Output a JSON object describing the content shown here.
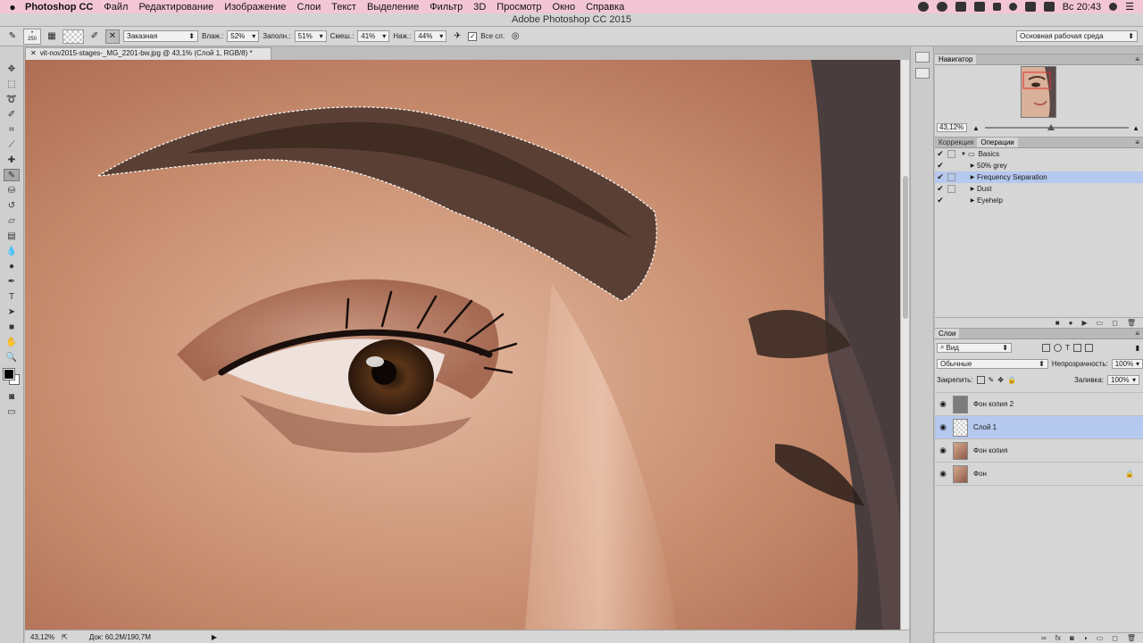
{
  "menubar": {
    "app_name": "Photoshop CC",
    "items": [
      "Файл",
      "Редактирование",
      "Изображение",
      "Слои",
      "Текст",
      "Выделение",
      "Фильтр",
      "3D",
      "Просмотр",
      "Окно",
      "Справка"
    ],
    "time": "Вс 20:43"
  },
  "window": {
    "title": "Adobe Photoshop CC 2015"
  },
  "options": {
    "brush_size": "250",
    "mode": "Заказная",
    "wet_label": "Влаж.:",
    "wet_value": "52%",
    "load_label": "Заполн.:",
    "load_value": "51%",
    "mix_label": "Смеш.:",
    "mix_value": "41%",
    "flow_label": "Наж.:",
    "flow_value": "44%",
    "all_layers_label": "Все сл.",
    "workspace": "Основная рабочая среда"
  },
  "document": {
    "tab_title": "vit-nov2015-stages-_MG_2201-bw.jpg @ 43,1% (Слой 1, RGB/8) *"
  },
  "status": {
    "zoom": "43,12%",
    "doc_size": "Док: 60,2M/190,7M"
  },
  "navigator": {
    "title": "Навигатор",
    "zoom": "43,12%"
  },
  "actions_panel": {
    "tabs": [
      "Коррекция",
      "Операции"
    ],
    "items": [
      {
        "label": "Basics",
        "checked": true,
        "has_dialog": false,
        "expanded": true,
        "is_set": true
      },
      {
        "label": "50% grey",
        "checked": true,
        "has_dialog": false,
        "selected": false
      },
      {
        "label": "Frequency Separation",
        "checked": true,
        "has_dialog": true,
        "selected": true
      },
      {
        "label": "Dust",
        "checked": true,
        "has_dialog": true,
        "selected": false
      },
      {
        "label": "Eyehelp",
        "checked": true,
        "has_dialog": false,
        "selected": false
      }
    ]
  },
  "layers_panel": {
    "title": "Слои",
    "filter": "Вид",
    "blend_mode": "Обычные",
    "opacity_label": "Непрозрачность:",
    "opacity_value": "100%",
    "lock_label": "Закрепить:",
    "fill_label": "Заливка:",
    "fill_value": "100%",
    "layers": [
      {
        "name": "Фон копия 2",
        "visible": true,
        "selected": false,
        "thumb": "gray",
        "locked": false
      },
      {
        "name": "Слой 1",
        "visible": true,
        "selected": true,
        "thumb": "transparent",
        "locked": false
      },
      {
        "name": "Фон копия",
        "visible": true,
        "selected": false,
        "thumb": "face",
        "locked": false
      },
      {
        "name": "Фон",
        "visible": true,
        "selected": false,
        "thumb": "face",
        "locked": true
      }
    ]
  },
  "colors": {
    "selection_highlight": "#b5c8ee",
    "menubar": "#f3c6d5",
    "panel": "#d6d6d6"
  }
}
